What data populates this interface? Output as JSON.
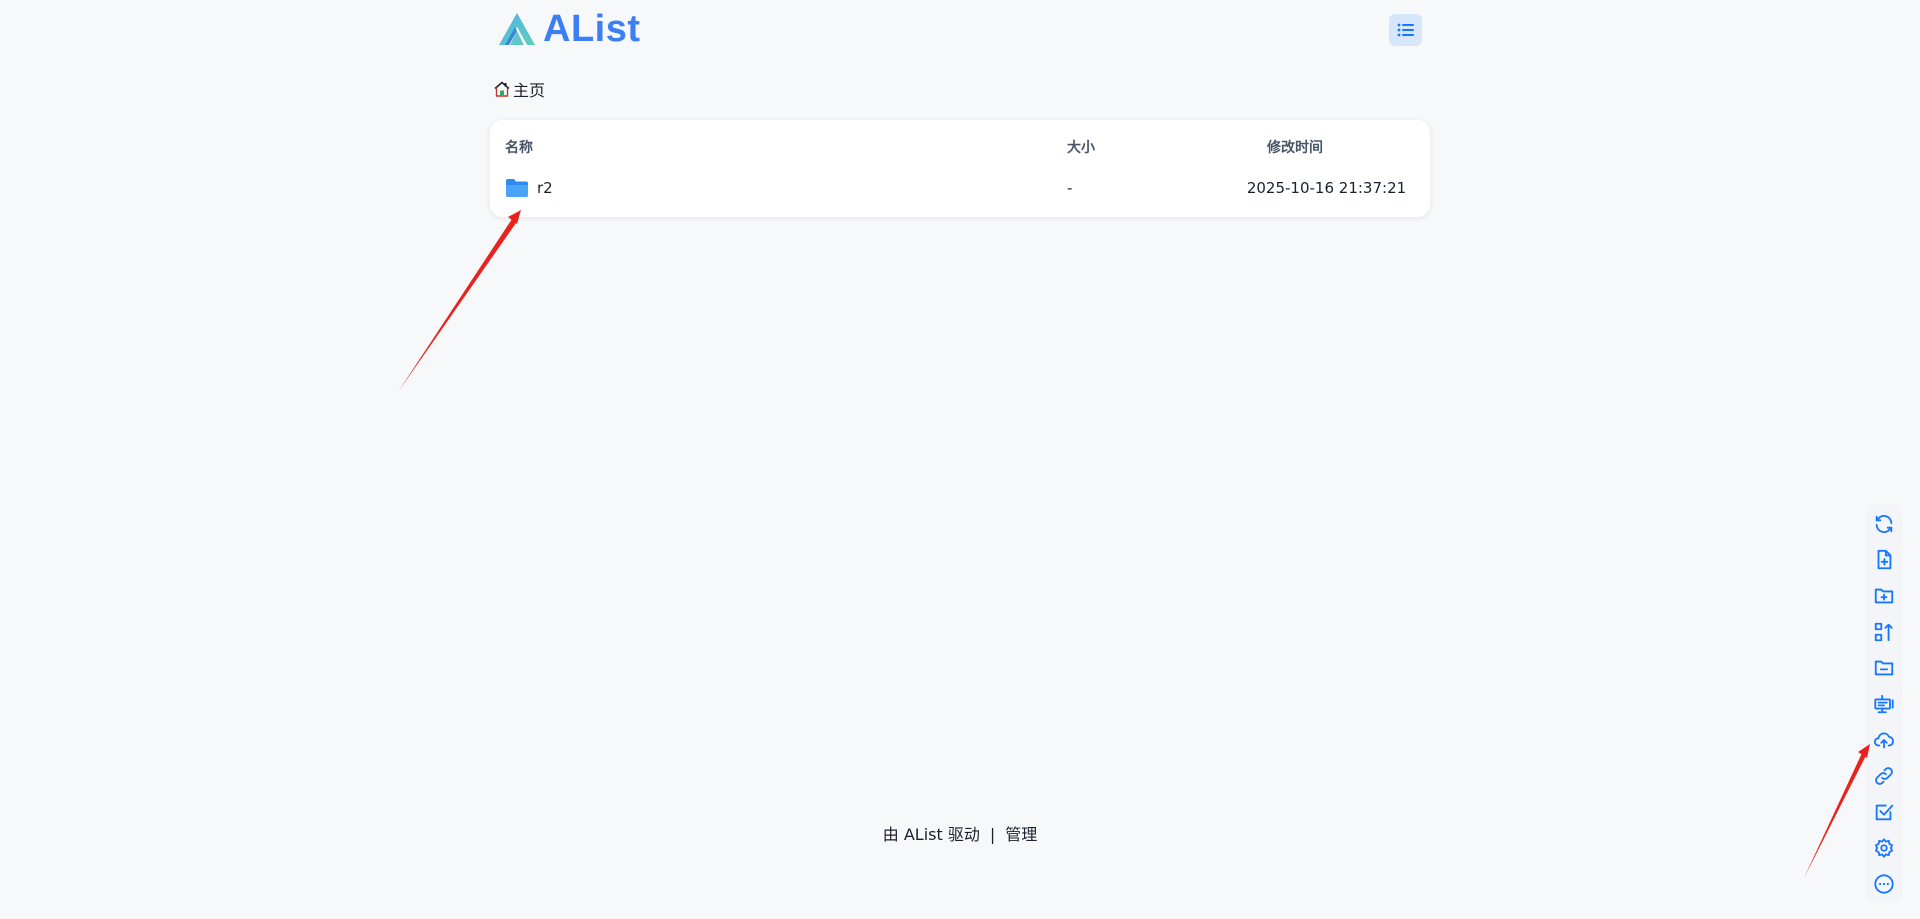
{
  "header": {
    "brand": "AList",
    "logo_icon": "alist-logo-icon",
    "layout_toggle_icon": "list-view-icon",
    "accent_color": "#3c7ff5"
  },
  "breadcrumb": {
    "home_icon": "home-icon",
    "home_label": "主页"
  },
  "file_list": {
    "columns": {
      "name": "名称",
      "size": "大小",
      "modified": "修改时间"
    },
    "rows": [
      {
        "icon": "folder-icon",
        "name": "r2",
        "size": "-",
        "modified": "2025-10-16 21:37:21"
      }
    ]
  },
  "footer": {
    "powered_by": "由 AList 驱动",
    "separator": "|",
    "manage": "管理"
  },
  "toolbar": {
    "icon_color": "#1677ff",
    "items": [
      "refresh-icon",
      "new-file-icon",
      "new-folder-icon",
      "sort-icon",
      "folder-collapse-icon",
      "offline-download-icon",
      "upload-icon",
      "link-icon",
      "checkbox-icon",
      "settings-icon",
      "more-icon"
    ]
  },
  "annotations": {
    "arrow_color": "#e8231e"
  }
}
